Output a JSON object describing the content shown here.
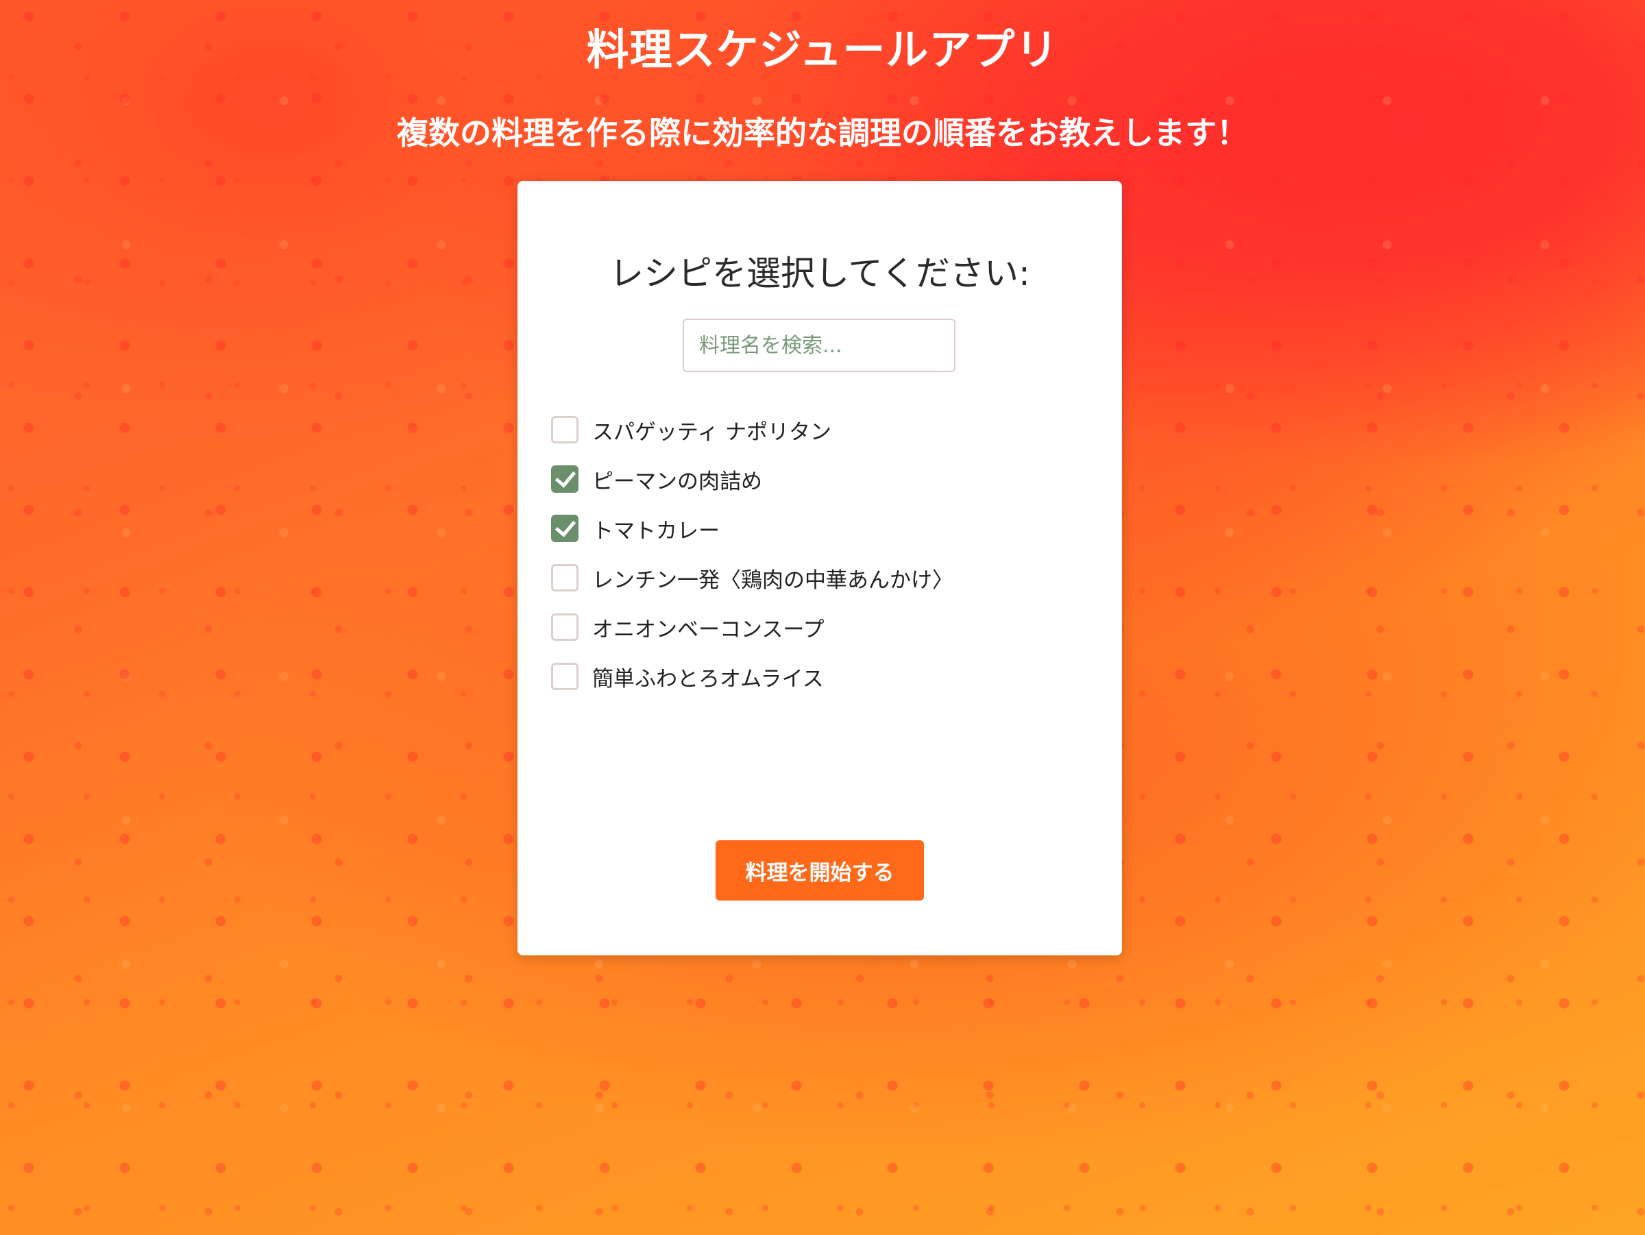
{
  "header": {
    "title": "料理スケジュールアプリ",
    "subtitle": "複数の料理を作る際に効率的な調理の順番をお教えします！"
  },
  "card": {
    "heading": "レシピを選択してください:",
    "search": {
      "placeholder": "料理名を検索...",
      "value": ""
    },
    "recipes": [
      {
        "label": "スパゲッティ ナポリタン",
        "checked": false
      },
      {
        "label": "ピーマンの肉詰め",
        "checked": true
      },
      {
        "label": "トマトカレー",
        "checked": true
      },
      {
        "label": "レンチン一発〈鶏肉の中華あんかけ〉",
        "checked": false
      },
      {
        "label": "オニオンベーコンスープ",
        "checked": false
      },
      {
        "label": "簡単ふわとろオムライス",
        "checked": false
      }
    ],
    "start_button_label": "料理を開始する"
  },
  "colors": {
    "accent_button": "#ff6a1a",
    "checkbox_checked": "#6b8e6b",
    "background_red": "#ff2d2d",
    "background_orange": "#ffa424"
  }
}
